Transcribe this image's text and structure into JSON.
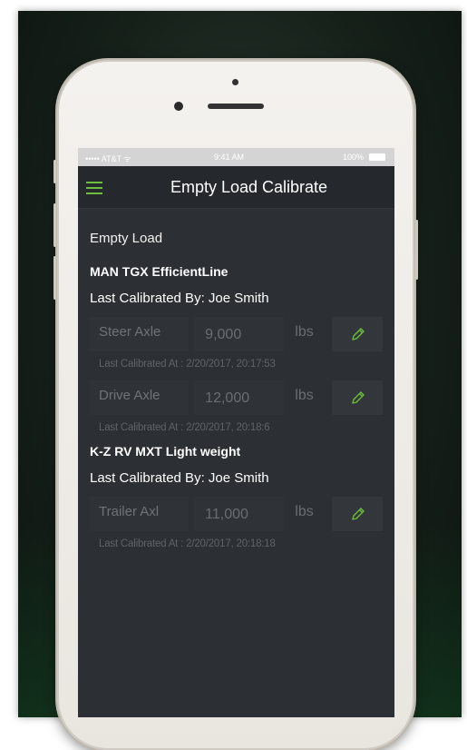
{
  "status_bar": {
    "carrier": "••••• AT&T ᯤ",
    "time": "9:41 AM",
    "battery": "100%"
  },
  "nav": {
    "title": "Empty Load Calibrate",
    "menu_icon": "hamburger-menu-icon",
    "accent_color": "#6bbf3b"
  },
  "page": {
    "section_title": "Empty Load"
  },
  "vehicles": [
    {
      "name": "MAN TGX EfficientLine",
      "last_calibrated_by": "Last Calibrated By: Joe Smith",
      "axles": [
        {
          "label": "Steer Axle",
          "value": "9,000",
          "unit": "lbs",
          "last_at": "Last Calibrated At : 2/20/2017, 20:17:53"
        },
        {
          "label": "Drive Axle",
          "value": "12,000",
          "unit": "lbs",
          "last_at": "Last Calibrated At : 2/20/2017, 20:18:6"
        }
      ]
    },
    {
      "name": "K-Z RV MXT Light weight",
      "last_calibrated_by": "Last Calibrated By: Joe Smith",
      "axles": [
        {
          "label": "Trailer Axl",
          "value": "11,000",
          "unit": "lbs",
          "last_at": "Last Calibrated At : 2/20/2017, 20:18:18"
        }
      ]
    }
  ],
  "icons": {
    "edit": "pencil-icon"
  }
}
